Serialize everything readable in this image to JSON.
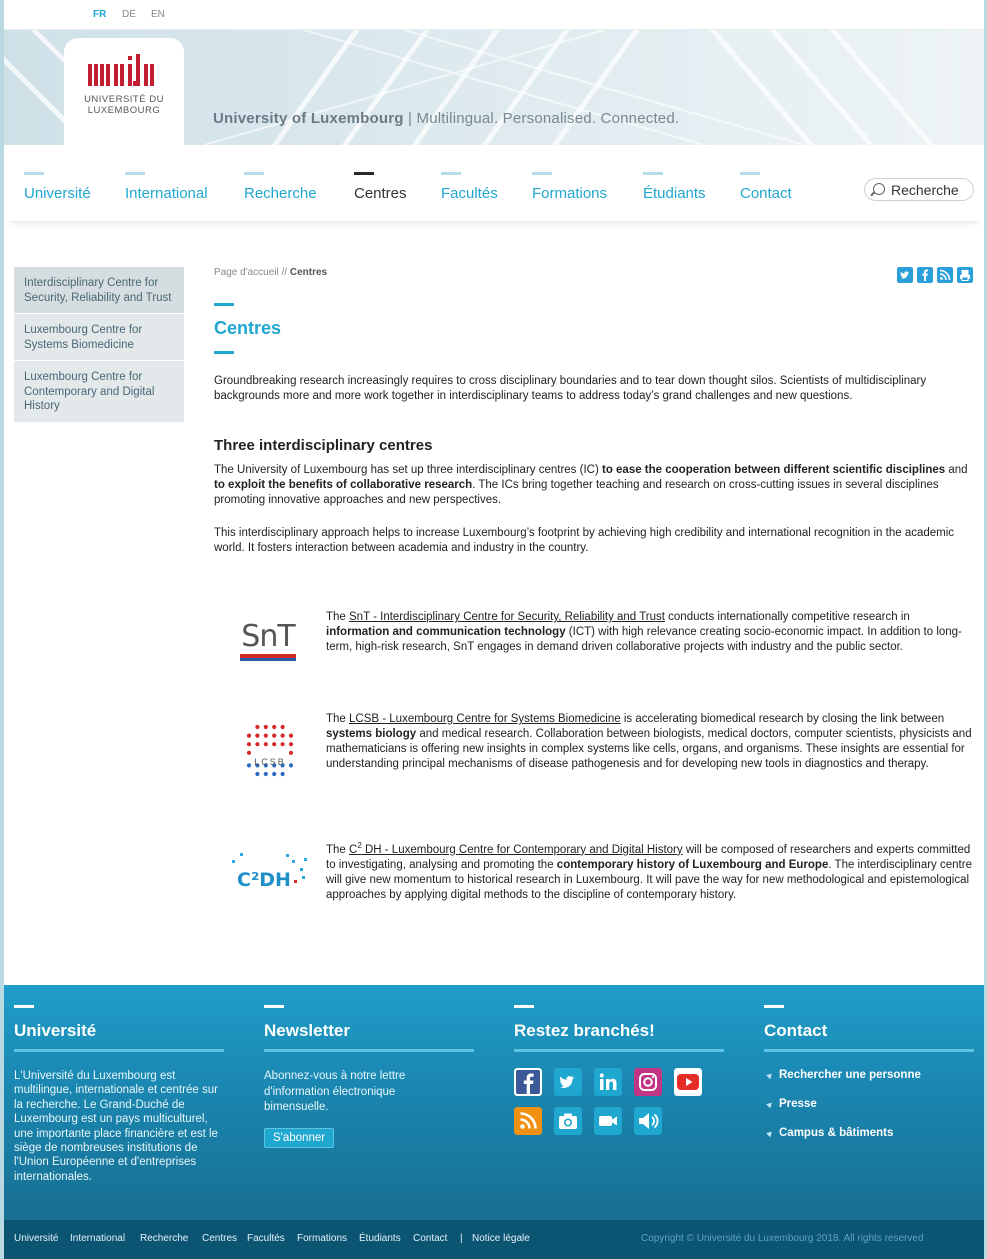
{
  "languages": [
    {
      "code": "FR",
      "active": true
    },
    {
      "code": "DE",
      "active": false
    },
    {
      "code": "EN",
      "active": false
    }
  ],
  "logo": {
    "mark": "uni.lu",
    "line1": "UNIVERSITÉ DU",
    "line2": "LUXEMBOURG"
  },
  "tagline": {
    "name": "University of Luxembourg",
    "rest": "| Multilingual. Personalised. Connected."
  },
  "nav": [
    "Université",
    "International",
    "Recherche",
    "Centres",
    "Facultés",
    "Formations",
    "Étudiants",
    "Contact"
  ],
  "nav_active": "Centres",
  "search": {
    "value": "Recherche"
  },
  "sidenav": [
    "Interdisciplinary Centre for Security, Reliability and Trust",
    "Luxembourg Centre for Systems Biomedicine",
    "Luxembourg Centre for Contemporary and Digital History"
  ],
  "breadcrumb": {
    "home": "Page d'accueil //",
    "current": "Centres"
  },
  "share_icons": [
    "twitter-icon",
    "facebook-icon",
    "rss-icon",
    "print-icon"
  ],
  "content": {
    "title": "Centres",
    "intro": "Groundbreaking research increasingly requires to cross disciplinary boundaries and to tear down thought silos. Scientists of multidisciplinary backgrounds more and more work together in interdisciplinary teams to address today’s grand challenges and new questions.",
    "subtitle": "Three interdisciplinary centres",
    "p1a": "The University of Luxembourg has set up three interdisciplinary centres (IC) ",
    "p1b": "to ease the cooperation between different scientific disciplines",
    "p1c": " and ",
    "p1d": "to exploit the benefits of collaborative research",
    "p1e": ". The ICs bring together teaching and research on cross-cutting issues in several disciplines promoting innovative approaches and new perspectives.",
    "p2": "This interdisciplinary approach helps to increase Luxembourg’s footprint by achieving high credibility and international recognition in the academic world. It fosters interaction between academia and industry in the country."
  },
  "centres": [
    {
      "logo": "SnT",
      "pre": "The ",
      "link": "SnT - Interdisciplinary Centre for Security, Reliability and Trust",
      "mid": " conducts internationally competitive research in ",
      "bold": "information and communication technology",
      "post": " (ICT) with high relevance creating socio-economic impact. In addition to long-term, high-risk research, SnT engages in demand driven collaborative projects with industry and the public sector."
    },
    {
      "logo": "LCSB",
      "pre": "The ",
      "link": "LCSB - Luxembourg Centre for Systems Biomedicine",
      "mid": " is accelerating biomedical research by closing the link between ",
      "bold": "systems biology",
      "post": " and medical research. Collaboration between biologists, medical doctors, computer scientists, physicists and mathematicians is offering new insights in complex systems like cells, organs, and organisms. These insights are essential for understanding principal mechanisms of disease pathogenesis and for developing new tools in diagnostics and therapy."
    },
    {
      "logo": "C²DH",
      "pre": "The ",
      "link_pre": "C",
      "link_sup": "2",
      "link": " DH - Luxembourg Centre for Contemporary and Digital History",
      "mid": " will be composed of researchers and experts committed to investigating, analysing and promoting the ",
      "bold": "contemporary history of Luxembourg and Europe",
      "post": ". The interdisciplinary centre will give new momentum to historical research in Luxembourg. It will pave the way for new methodological and epistemological approaches by applying digital methods to the discipline of contemporary history."
    }
  ],
  "footer": {
    "universite": {
      "title": "Université",
      "text": "L'Université du Luxembourg est multilingue, internationale et centrée sur la recherche. Le Grand-Duché de Luxembourg est un pays multiculturel, une importante place financière et est le siège de nombreuses institutions de l'Union Européenne et d'entreprises internationales."
    },
    "newsletter": {
      "title": "Newsletter",
      "text": "Abonnez-vous à notre lettre d'information électronique bimensuelle.",
      "button": "S'abonner"
    },
    "social": {
      "title": "Restez branchés!",
      "icons": [
        "facebook-icon",
        "twitter-icon",
        "linkedin-icon",
        "instagram-icon",
        "youtube-icon",
        "rss-icon",
        "camera-icon",
        "video-icon",
        "podcast-icon"
      ]
    },
    "contact": {
      "title": "Contact",
      "links": [
        "Rechercher une personne",
        "Presse",
        "Campus & bâtiments"
      ]
    }
  },
  "bottombar": {
    "links": [
      "Université",
      "International",
      "Recherche",
      "Centres",
      "Facultés",
      "Formations",
      "Étudiants",
      "Contact",
      "|",
      "Notice légale"
    ],
    "copyright": "Copyright © Université du Luxembourg 2018. All rights reserved"
  },
  "colors": {
    "accent": "#1fa7d0",
    "brand_red": "#c21e32",
    "footer_dark": "#0b5573"
  }
}
